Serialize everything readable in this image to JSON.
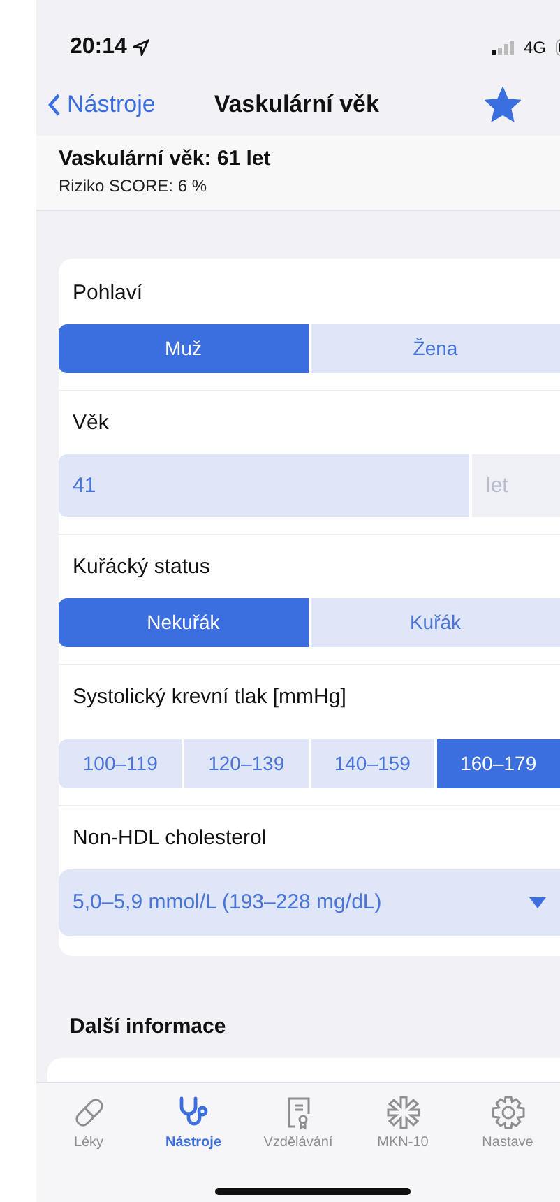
{
  "status_bar": {
    "time": "20:14",
    "network": "4G"
  },
  "nav": {
    "back": "Nástroje",
    "title": "Vaskulární věk",
    "favorite": true
  },
  "summary": {
    "title": "Vaskulární věk: 61 let",
    "subtitle": "Riziko SCORE: 6 %"
  },
  "form": [
    {
      "kind": "segments",
      "label": "Pohlaví",
      "options": [
        {
          "label": "Muž",
          "selected": true
        },
        {
          "label": "Žena",
          "selected": false
        }
      ]
    },
    {
      "kind": "number",
      "label": "Věk",
      "value": "41",
      "unit": "let"
    },
    {
      "kind": "segments",
      "label": "Kuřácký status",
      "options": [
        {
          "label": "Nekuřák",
          "selected": true
        },
        {
          "label": "Kuřák",
          "selected": false
        }
      ]
    },
    {
      "kind": "segments",
      "label": "Systolický krevní tlak [mmHg]",
      "options": [
        {
          "label": "100–119",
          "selected": false
        },
        {
          "label": "120–139",
          "selected": false
        },
        {
          "label": "140–159",
          "selected": false
        },
        {
          "label": "160–179",
          "selected": true
        }
      ]
    },
    {
      "kind": "dropdown",
      "label": "Non-HDL cholesterol",
      "value": "5,0–5,9 mmol/L (193–228 mg/dL)"
    }
  ],
  "section": {
    "title": "Další informace"
  },
  "tab_bar": [
    {
      "label": "Léky",
      "kind": "pill",
      "selected": false
    },
    {
      "label": "Nástroje",
      "kind": "stethoscope",
      "selected": true
    },
    {
      "label": "Vzdělávání",
      "kind": "certificate",
      "selected": false
    },
    {
      "label": "MKN-10",
      "kind": "asterisk",
      "selected": false
    },
    {
      "label": "Nastave",
      "kind": "gear",
      "selected": false
    }
  ]
}
